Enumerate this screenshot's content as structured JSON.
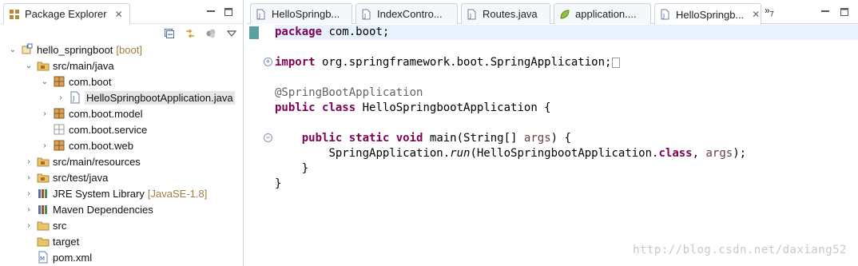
{
  "explorer": {
    "title": "Package Explorer",
    "tree": [
      {
        "label": "hello_springboot",
        "deco": "[boot]",
        "icon": "maven-project-icon",
        "expanded": true
      },
      {
        "label": "src/main/java",
        "icon": "source-folder-icon",
        "expanded": true
      },
      {
        "label": "com.boot",
        "icon": "package-icon",
        "expanded": true
      },
      {
        "label": "HelloSpringbootApplication.java",
        "icon": "java-file-icon",
        "selected": true
      },
      {
        "label": "com.boot.model",
        "icon": "package-icon"
      },
      {
        "label": "com.boot.service",
        "icon": "empty-package-icon"
      },
      {
        "label": "com.boot.web",
        "icon": "package-icon"
      },
      {
        "label": "src/main/resources",
        "icon": "source-folder-icon"
      },
      {
        "label": "src/test/java",
        "icon": "source-folder-icon"
      },
      {
        "label": "JRE System Library",
        "deco": "[JavaSE-1.8]",
        "icon": "library-icon"
      },
      {
        "label": "Maven Dependencies",
        "icon": "library-icon"
      },
      {
        "label": "src",
        "icon": "folder-icon"
      },
      {
        "label": "target",
        "icon": "folder-icon"
      },
      {
        "label": "pom.xml",
        "icon": "maven-pom-icon"
      }
    ]
  },
  "editor": {
    "tabs": [
      {
        "label": "HelloSpringb...",
        "icon": "java-file-icon"
      },
      {
        "label": "IndexContro...",
        "icon": "java-file-icon"
      },
      {
        "label": "Routes.java",
        "icon": "java-file-icon"
      },
      {
        "label": "application....",
        "icon": "properties-file-icon"
      },
      {
        "label": "HelloSpringb...",
        "icon": "java-file-icon",
        "active": true
      }
    ],
    "overflow_label": "»",
    "overflow_count": "7",
    "code": {
      "l1_kw": "package",
      "l1_rest": " com.boot;",
      "l2_kw": "import",
      "l2_rest": " org.springframework.boot.SpringApplication;",
      "l3_ann": "@SpringBootApplication",
      "l4_kw1": "public",
      "l4_kw2": "class",
      "l4_rest": " HelloSpringbootApplication {",
      "l5_kw1": "public",
      "l5_kw2": "static",
      "l5_kw3": "void",
      "l5_mid": " main(String[] ",
      "l5_param": "args",
      "l5_end": ") {",
      "l6_pre": "SpringApplication.",
      "l6_call": "run",
      "l6_mid": "(HelloSpringbootApplication.",
      "l6_kw": "class",
      "l6_comma": ", ",
      "l6_param": "args",
      "l6_end": ");",
      "l7": "}",
      "l8": "}"
    },
    "watermark": "http://blog.csdn.net/daxiang52"
  },
  "colors": {
    "keyword": "#7f0055",
    "annotation": "#646464",
    "param": "#6a3e3e",
    "current_line": "#e8f2fe"
  }
}
